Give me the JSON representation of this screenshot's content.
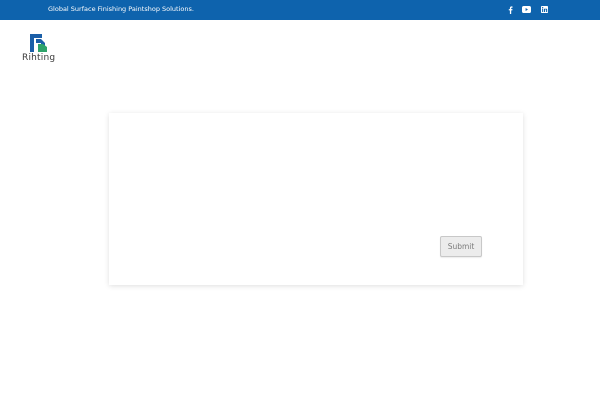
{
  "topbar": {
    "tagline": "Global Surface Finishing Paintshop Solutions.",
    "background_color": "#0e63ad",
    "social": [
      {
        "icon": "facebook-icon"
      },
      {
        "icon": "youtube-icon"
      },
      {
        "icon": "linkedin-icon"
      }
    ]
  },
  "header": {
    "logo_text": "Rihting",
    "logo_colors": {
      "blue": "#1b5fa8",
      "green": "#2ea36a"
    }
  },
  "form": {
    "submit_label": "Submit"
  }
}
